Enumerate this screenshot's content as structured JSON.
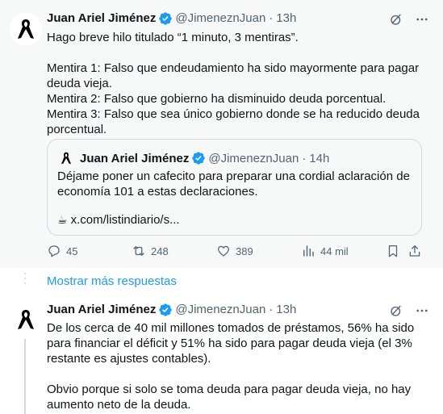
{
  "tweet1": {
    "name": "Juan Ariel Jiménez",
    "handle": "@JimeneznJuan",
    "time": "13h",
    "text": "Hago breve hilo titulado “1 minuto, 3 mentiras”.\n\nMentira 1: Falso que endeudamiento ha sido mayormente para pagar deuda vieja.\nMentira 2: Falso que gobierno ha disminuido deuda porcentual.\nMentira 3: Falso que sea único gobierno donde se ha reducido deuda porcentual.",
    "quote": {
      "name": "Juan Ariel Jiménez",
      "handle": "@JimeneznJuan",
      "time": "14h",
      "text": "Déjame poner un cafecito para preparar una cordial aclaración de economía 101 a estas declaraciones.",
      "link_icon": "☕",
      "link": "x.com/listindiario/s..."
    },
    "actions": {
      "replies": "45",
      "reposts": "248",
      "likes": "389",
      "views": "44 mil"
    }
  },
  "more_replies": "Mostrar más respuestas",
  "tweet2": {
    "name": "Juan Ariel Jiménez",
    "handle": "@JimeneznJuan",
    "time": "13h",
    "text": "De los cerca de 40 mil millones tomados de préstamos, 56% ha sido para financiar el déficit y 51% ha sido para pagar deuda vieja (el 3% restante es ajustes contables).\n\nObvio porque si solo se toma deuda para pagar deuda vieja, no hay aumento neto de la deuda."
  },
  "separator": "·",
  "icons": {
    "avatar": "black-ribbon-icon",
    "verified": "verified-badge-icon",
    "grok": "grok-icon",
    "more": "more-icon",
    "reply": "reply-icon",
    "repost": "repost-icon",
    "like": "heart-icon",
    "views": "views-icon",
    "bookmark": "bookmark-icon",
    "share": "share-icon"
  },
  "colors": {
    "accent": "#1d9bf0",
    "muted": "#536471",
    "text": "#0f1419",
    "highlight_bg": "#f7f9f9"
  }
}
